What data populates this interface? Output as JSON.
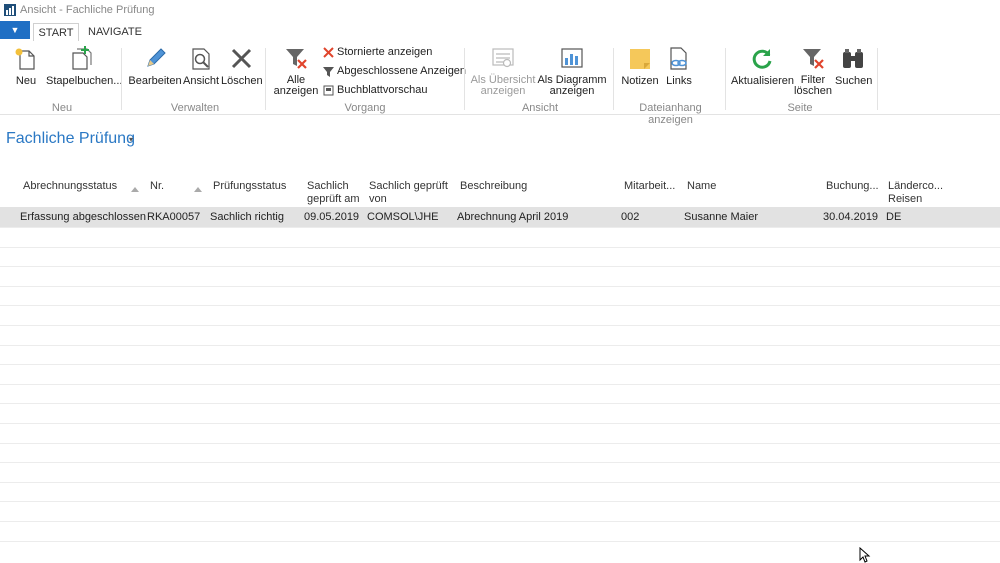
{
  "window": {
    "title": "Ansicht - Fachliche Prüfung"
  },
  "tabs": {
    "menu": "▼",
    "start": "START",
    "navigate": "NAVIGATE"
  },
  "ribbon": {
    "neu": "Neu",
    "stapelbuchen": "Stapelbuchen...",
    "bearbeiten": "Bearbeiten",
    "ansicht": "Ansicht",
    "loeschen": "Löschen",
    "alle_anzeigen_1": "Alle",
    "alle_anzeigen_2": "anzeigen",
    "stornierte": "Stornierte anzeigen",
    "abgeschlossene": "Abgeschlossene Anzeigen",
    "buchblatt": "Buchblattvorschau",
    "als_uebersicht_1": "Als Übersicht",
    "als_uebersicht_2": "anzeigen",
    "als_diagramm_1": "Als Diagramm",
    "als_diagramm_2": "anzeigen",
    "notizen": "Notizen",
    "links": "Links",
    "aktualisieren": "Aktualisieren",
    "filter_1": "Filter",
    "filter_2": "löschen",
    "suchen": "Suchen"
  },
  "groups": {
    "neu": "Neu",
    "verwalten": "Verwalten",
    "vorgang": "Vorgang",
    "ansicht": "Ansicht",
    "dateianhang": "Dateianhang anzeigen",
    "seite": "Seite"
  },
  "page": {
    "title": "Fachliche Prüfung",
    "caret": "▾"
  },
  "columns": {
    "abrechnungsstatus": "Abrechnungsstatus",
    "nr": "Nr.",
    "pruefungsstatus": "Prüfungsstatus",
    "sachlich_am_1": "Sachlich",
    "sachlich_am_2": "geprüft am",
    "sachlich_von_1": "Sachlich geprüft",
    "sachlich_von_2": "von",
    "beschreibung": "Beschreibung",
    "mitarbeiter": "Mitarbeit...",
    "name": "Name",
    "buchung": "Buchung...",
    "laender_1": "Länderco...",
    "laender_2": "Reisen"
  },
  "rows": [
    {
      "abrechnungsstatus": "Erfassung abgeschlossen",
      "nr": "RKA00057",
      "pruefungsstatus": "Sachlich richtig",
      "sachlich_am": "09.05.2019",
      "sachlich_von": "COMSOL\\JHE",
      "beschreibung": "Abrechnung April 2019",
      "mitarbeiter": "002",
      "name": "Susanne Maier",
      "buchung": "30.04.2019",
      "laender": "DE"
    }
  ],
  "colors": {
    "accent": "#2a78c4",
    "menu": "#1f6fc4",
    "selected_row": "#e2e2e2"
  }
}
